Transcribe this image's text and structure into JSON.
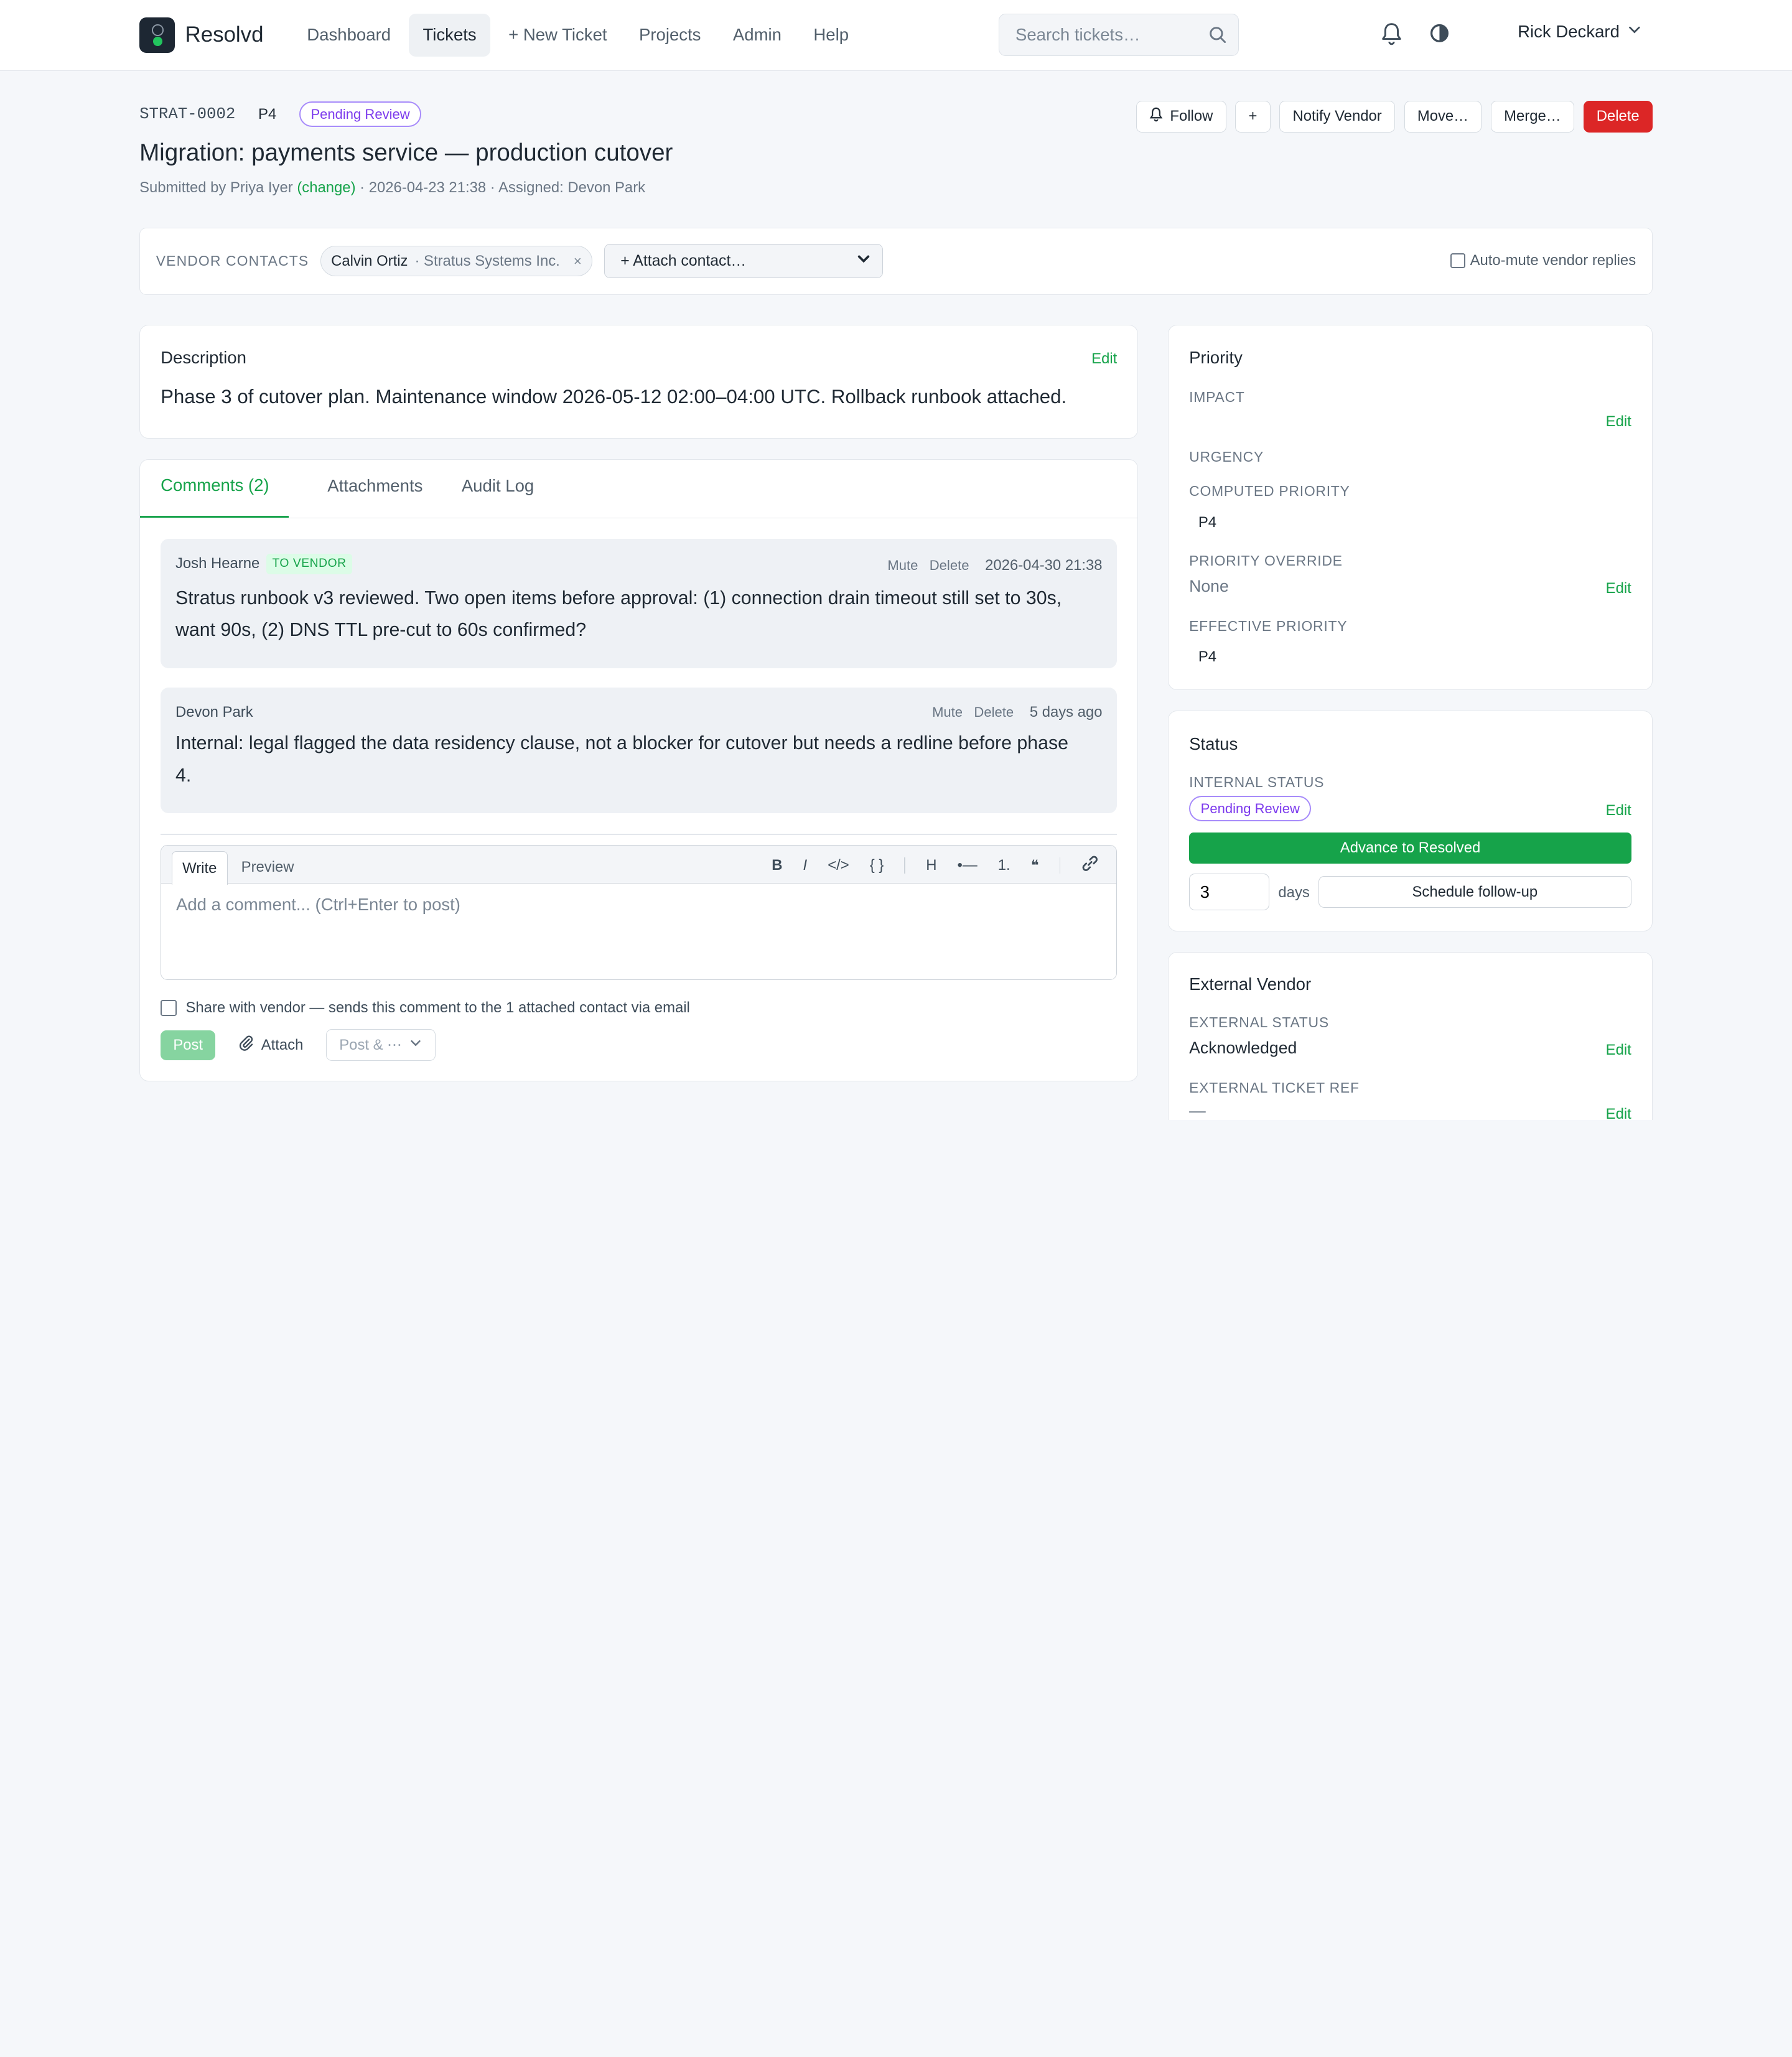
{
  "app": {
    "name": "Resolvd"
  },
  "nav": {
    "items": [
      {
        "label": "Dashboard"
      },
      {
        "label": "Tickets"
      },
      {
        "label": "+ New Ticket"
      },
      {
        "label": "Projects"
      },
      {
        "label": "Admin"
      },
      {
        "label": "Help"
      }
    ]
  },
  "search": {
    "placeholder": "Search tickets…"
  },
  "user": {
    "name": "Rick Deckard"
  },
  "ticket": {
    "id": "STRAT-0002",
    "priority": "P4",
    "status": "Pending Review",
    "title": "Migration: payments service — production cutover",
    "submitted_prefix": "Submitted by Priya Iyer",
    "change_link": "(change)",
    "submitted_suffix": "· 2026-04-23 21:38 · Assigned: Devon Park"
  },
  "actions": {
    "follow": "Follow",
    "plus": "+",
    "notify_vendor": "Notify Vendor",
    "move": "Move…",
    "merge": "Merge…",
    "delete": "Delete"
  },
  "vendor_contacts": {
    "label": "VENDOR CONTACTS",
    "contact_name": "Calvin Ortiz",
    "contact_org": "· Stratus Systems Inc.",
    "remove": "×",
    "attach_select": "+ Attach contact…",
    "auto_mute": "Auto-mute vendor replies"
  },
  "description": {
    "title": "Description",
    "edit": "Edit",
    "body": "Phase 3 of cutover plan. Maintenance window 2026-05-12 02:00–04:00 UTC. Rollback runbook attached."
  },
  "tabs": [
    {
      "label": "Comments (2)"
    },
    {
      "label": "Attachments"
    },
    {
      "label": "Audit Log"
    }
  ],
  "comments": [
    {
      "author": "Josh Hearne",
      "badge": "TO VENDOR",
      "mute": "Mute",
      "delete": "Delete",
      "timestamp": "2026-04-30 21:38",
      "text": "Stratus runbook v3 reviewed. Two open items before approval: (1) connection drain timeout still set to 30s, want 90s, (2) DNS TTL pre-cut to 60s confirmed?"
    },
    {
      "author": "Devon Park",
      "mute": "Mute",
      "delete": "Delete",
      "timestamp": "5 days ago",
      "text": "Internal: legal flagged the data residency clause, not a blocker for cutover but needs a redline before phase 4."
    }
  ],
  "editor": {
    "write_tab": "Write",
    "preview_tab": "Preview",
    "tools": {
      "bold": "B",
      "italic": "I",
      "code": "</>",
      "braces": "{ }",
      "heading": "H",
      "bullet": "•—",
      "numbered": "1.",
      "quote": "❝"
    },
    "placeholder": "Add a comment... (Ctrl+Enter to post)",
    "share_label": "Share with vendor — sends this comment to the 1 attached contact via email",
    "post": "Post",
    "attach": "Attach",
    "post_more": "Post & ⋯"
  },
  "priority_panel": {
    "title": "Priority",
    "impact_label": "IMPACT",
    "impact_edit": "Edit",
    "urgency_label": "URGENCY",
    "computed_label": "COMPUTED PRIORITY",
    "computed_value": "P4",
    "override_label": "PRIORITY OVERRIDE",
    "override_value": "None",
    "override_edit": "Edit",
    "effective_label": "EFFECTIVE PRIORITY",
    "effective_value": "P4"
  },
  "status_panel": {
    "title": "Status",
    "internal_label": "INTERNAL STATUS",
    "internal_value": "Pending Review",
    "edit": "Edit",
    "advance": "Advance to Resolved",
    "days_value": "3",
    "days_label": "days",
    "schedule": "Schedule follow-up"
  },
  "vendor_panel": {
    "title": "External Vendor",
    "ext_status_label": "EXTERNAL STATUS",
    "ext_status_value": "Acknowledged",
    "ext_status_edit": "Edit",
    "ext_ref_label": "EXTERNAL TICKET REF",
    "ext_ref_value": "—",
    "ext_ref_edit": "Edit"
  },
  "colors": {
    "accent_green": "#16a34a",
    "danger_red": "#dc2626",
    "status_purple": "#7c3aed"
  }
}
